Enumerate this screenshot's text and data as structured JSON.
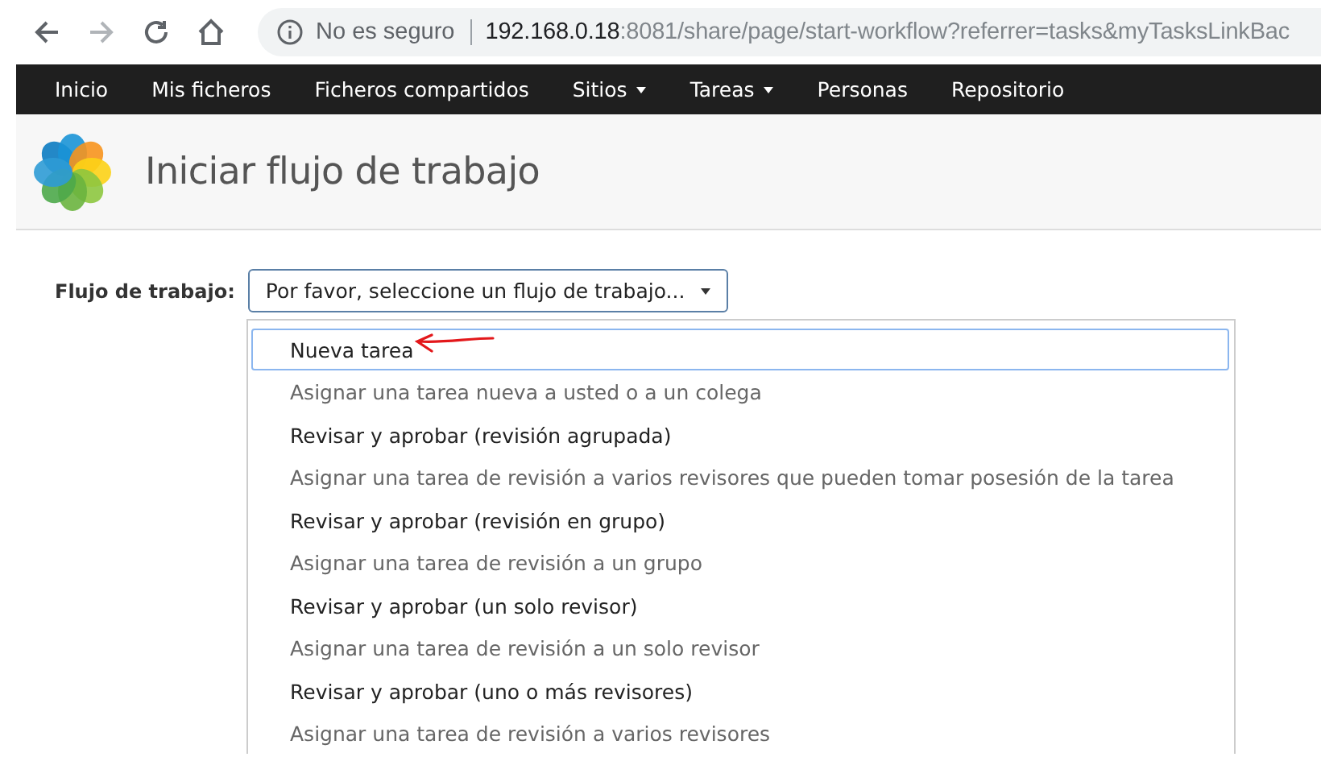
{
  "browser": {
    "security": "No es seguro",
    "url_host": "192.168.0.18",
    "url_rest": ":8081/share/page/start-workflow?referrer=tasks&myTasksLinkBac"
  },
  "nav": [
    {
      "label": "Inicio",
      "dropdown": false
    },
    {
      "label": "Mis ficheros",
      "dropdown": false
    },
    {
      "label": "Ficheros compartidos",
      "dropdown": false
    },
    {
      "label": "Sitios",
      "dropdown": true
    },
    {
      "label": "Tareas",
      "dropdown": true
    },
    {
      "label": "Personas",
      "dropdown": false
    },
    {
      "label": "Repositorio",
      "dropdown": false
    }
  ],
  "header": {
    "title": "Iniciar flujo de trabajo"
  },
  "form": {
    "label": "Flujo de trabajo:",
    "select": "Por favor, seleccione un flujo de trabajo..."
  },
  "options": [
    {
      "title": "Nueva tarea",
      "description": "Asignar una tarea nueva a usted o a un colega",
      "selected": true
    },
    {
      "title": "Revisar y aprobar (revisión agrupada)",
      "description": "Asignar una tarea de revisión a varios revisores que pueden tomar posesión de la tarea",
      "selected": false
    },
    {
      "title": "Revisar y aprobar (revisión en grupo)",
      "description": "Asignar una tarea de revisión a un grupo",
      "selected": false
    },
    {
      "title": "Revisar y aprobar (un solo revisor)",
      "description": "Asignar una tarea de revisión a un solo revisor",
      "selected": false
    },
    {
      "title": "Revisar y aprobar (uno o más revisores)",
      "description": "Asignar una tarea de revisión a varios revisores",
      "selected": false
    }
  ]
}
